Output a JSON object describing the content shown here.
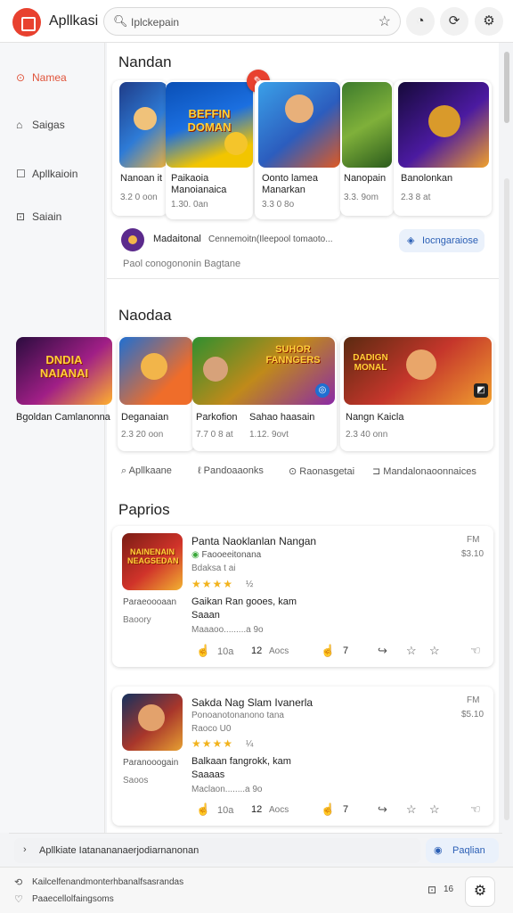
{
  "app": {
    "title": "Apllkasi"
  },
  "search": {
    "value": "Iplckepain"
  },
  "sidebar": {
    "items": [
      {
        "label": "Namea",
        "icon": "games-icon",
        "active": true
      },
      {
        "label": "Saigas",
        "icon": "tag-icon",
        "active": false
      },
      {
        "label": "Apllkaioin",
        "icon": "apps-icon",
        "active": false
      },
      {
        "label": "Saiain",
        "icon": "books-icon",
        "active": false
      }
    ]
  },
  "section1": {
    "title": "Nandan",
    "cards": [
      {
        "title": "Nanoan it",
        "sub": "3.2 0 oon",
        "cover": ""
      },
      {
        "title": "Paikaoia",
        "title2": "Manoianaica",
        "sub": "1.30. 0an",
        "cover": "BEFFIN\nDOMAN"
      },
      {
        "title": "Oonto lamea",
        "title2": "Manarkan",
        "sub": "3.3 0 8o",
        "cover": ""
      },
      {
        "title": "Nanopain",
        "sub": "3.3. 9om",
        "cover": ""
      },
      {
        "title": "Banolonkan",
        "sub": "2.3 8 at",
        "cover": ""
      }
    ],
    "developer": {
      "name": "Madaitonal",
      "desc": "Cennemoitn(Ileepool tomaoto...",
      "caption": "Paol conogononin  Bagtane"
    },
    "install_label": "Iocngaraiose"
  },
  "section2": {
    "title": "Naodaa",
    "left_card": {
      "title": "Bgoldan Camlanonna",
      "cover": "DNDIA\nNAIANAI"
    },
    "cards": [
      {
        "title": "Deganaian",
        "sub": "2.3 20 oon",
        "cover": ""
      },
      {
        "title": "Parkofion",
        "sub": "7.7 0 8 at",
        "cover": "SUHOR\nFANNGERS"
      },
      {
        "title": "Sahao haasain",
        "sub": "1.12. 9ovt",
        "cover": ""
      },
      {
        "title": "Nangn Kaicla",
        "sub": "2.3 40 onn",
        "cover": "DADIGN\nMONAL"
      }
    ],
    "links": [
      {
        "label": "Apllkaane",
        "icon": "share-icon"
      },
      {
        "label": "Pandoaaonks",
        "icon": "link-icon"
      },
      {
        "label": "Raonasgetai",
        "icon": "clock-icon"
      },
      {
        "label": "Mandalonaoonnaices",
        "icon": "chat-icon"
      }
    ]
  },
  "section3": {
    "title": "Paprios",
    "reviews": [
      {
        "title": "Panta Naoklanlan Nangan",
        "meta": "Faooeeitonana",
        "sub2": "Bdaksa t ai",
        "stars": "★★★★",
        "star_note": "½",
        "tag": "FM",
        "tag2": "$3.10",
        "side_label": "Paraeoooaan",
        "side_label2": "Baoory",
        "body1": "Gaikan Ran gooes, kam",
        "body2": "Saaan",
        "body3": "Maaaoo.........a 9o",
        "cover": "NAINENAIN\nNEAGSEDAN",
        "likes": "10a",
        "count": "12",
        "count_label": "Aocs",
        "num": "7"
      },
      {
        "title": "Sakda Nag Slam Ivanerla",
        "meta": "Ponoanotonanono tana",
        "sub2": "Raoco U0",
        "stars": "★★★★",
        "star_note": "¼",
        "tag": "FM",
        "tag2": "$5.10",
        "side_label": "Paranooogain",
        "side_label2": "Saoos",
        "body1": "Balkaan fangrokk, kam",
        "body2": "Saaaas",
        "body3": "Maclaon........a 9o",
        "cover": "",
        "likes": "10a",
        "count": "12",
        "count_label": "Aocs",
        "num": "7"
      }
    ]
  },
  "bottom": {
    "text": "Apllkiate Iatanananaerjodiarnanonan",
    "button": "Paqlian"
  },
  "footer": {
    "line1": "Kailcelfenandmonterhbanalfsasrandas",
    "line2": "Paaecellolfaingsoms",
    "count": "16"
  },
  "colors": {
    "accent": "#e8412f",
    "link": "#2b5fb5",
    "stars": "#f2b31d"
  }
}
